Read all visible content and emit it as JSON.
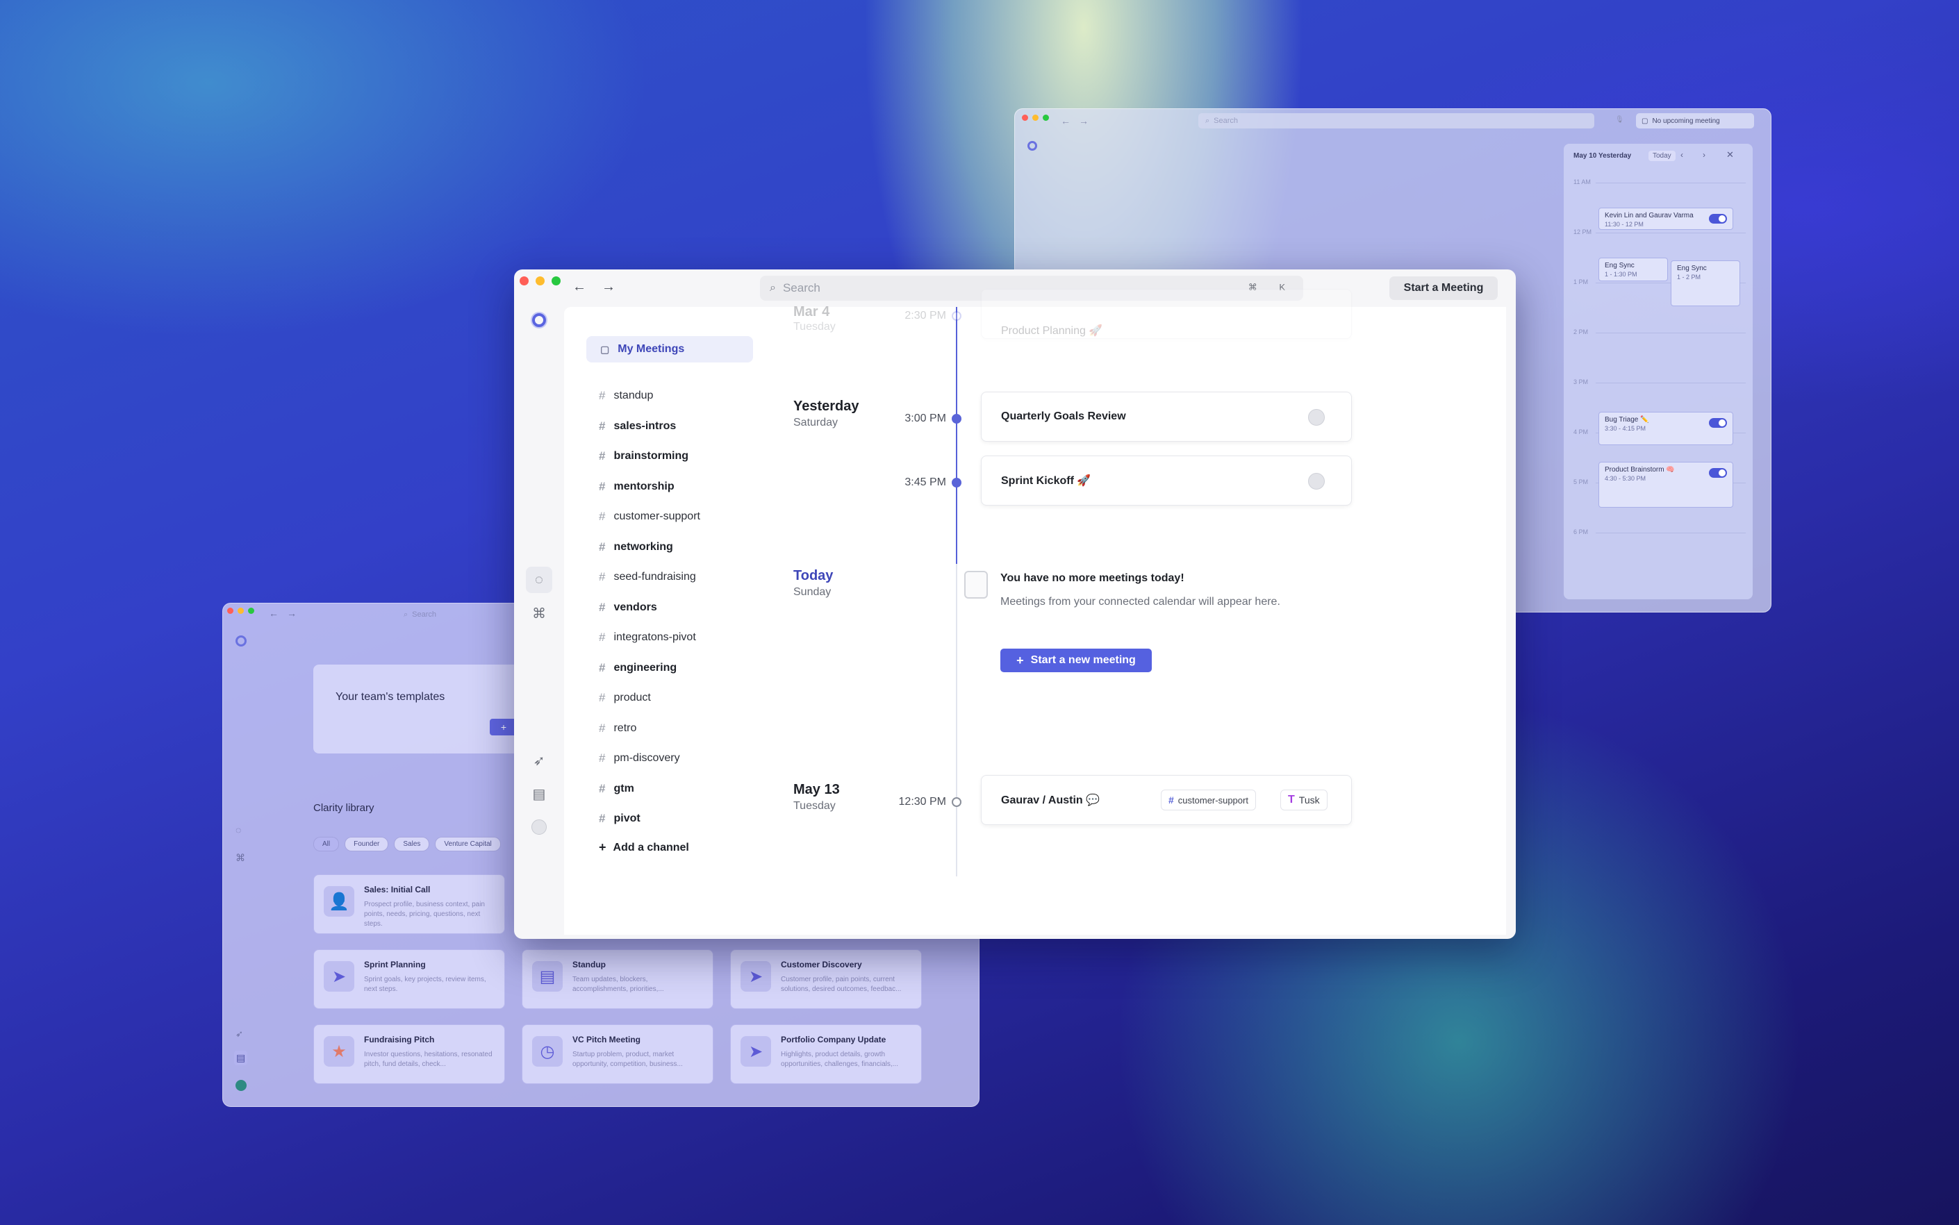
{
  "right_window": {
    "search_placeholder": "Search",
    "no_upcoming": "No upcoming meeting",
    "cal_header_date": "May 10",
    "cal_header_day": "Yesterday",
    "cal_today": "Today",
    "hours": [
      "11 AM",
      "12 PM",
      "1 PM",
      "2 PM",
      "3 PM",
      "4 PM",
      "5 PM",
      "6 PM"
    ],
    "events": [
      {
        "title": "Kevin Lin and Gaurav Varma",
        "time": "11:30 - 12 PM"
      },
      {
        "title": "Eng Sync",
        "time": "1 - 1:30 PM"
      },
      {
        "title": "Eng Sync",
        "time": "1 - 2 PM"
      },
      {
        "title": "Bug Triage ✏️",
        "time": "3:30 - 4:15 PM"
      },
      {
        "title": "Product Brainstorm 🧠",
        "time": "4:30 - 5:30 PM"
      }
    ]
  },
  "left_window": {
    "search_placeholder": "Search",
    "team_templates": "Your team's templates",
    "plus_label": "+",
    "library_title": "Clarity library",
    "filters": [
      "All",
      "Founder",
      "Sales",
      "Venture Capital"
    ],
    "templates": [
      {
        "title": "Sales: Initial Call",
        "desc": "Prospect profile, business context, pain points, needs, pricing, questions, next steps."
      },
      {
        "title": "Sprint Planning",
        "desc": "Sprint goals, key projects, review items, next steps."
      },
      {
        "title": "Standup",
        "desc": "Team updates, blockers, accomplishments, priorities,..."
      },
      {
        "title": "Customer Discovery",
        "desc": "Customer profile, pain points, current solutions, desired outcomes, feedbac..."
      },
      {
        "title": "Fundraising Pitch",
        "desc": "Investor questions, hesitations, resonated pitch, fund details, check..."
      },
      {
        "title": "VC Pitch Meeting",
        "desc": "Startup problem, product, market opportunity, competition, business..."
      },
      {
        "title": "Portfolio Company Update",
        "desc": "Highlights, product details, growth opportunities, challenges, financials,..."
      }
    ]
  },
  "main_window": {
    "search_placeholder": "Search",
    "shortcut": "⌘ K",
    "start_meeting": "Start a Meeting",
    "my_meetings": "My Meetings",
    "channels": [
      {
        "name": "standup",
        "bold": false
      },
      {
        "name": "sales-intros",
        "bold": true
      },
      {
        "name": "brainstorming",
        "bold": true
      },
      {
        "name": "mentorship",
        "bold": true
      },
      {
        "name": "customer-support",
        "bold": false
      },
      {
        "name": "networking",
        "bold": true
      },
      {
        "name": "seed-fundraising",
        "bold": false
      },
      {
        "name": "vendors",
        "bold": true
      },
      {
        "name": "integratons-pivot",
        "bold": false
      },
      {
        "name": "engineering",
        "bold": true
      },
      {
        "name": "product",
        "bold": false
      },
      {
        "name": "retro",
        "bold": false
      },
      {
        "name": "pm-discovery",
        "bold": false
      },
      {
        "name": "gtm",
        "bold": true
      },
      {
        "name": "pivot",
        "bold": true
      }
    ],
    "add_channel": "Add a channel",
    "timeline": {
      "faded_date": "Mar 4",
      "faded_day": "Tuesday",
      "faded_time": "2:30 PM",
      "faded_title": "Product Planning 🚀",
      "yesterday": "Yesterday",
      "yesterday_day": "Saturday",
      "meetings_yesterday": [
        {
          "time": "3:00 PM",
          "title": "Quarterly Goals Review"
        },
        {
          "time": "3:45 PM",
          "title": "Sprint Kickoff 🚀"
        }
      ],
      "today": "Today",
      "today_day": "Sunday",
      "empty_title": "You have no more meetings today!",
      "empty_desc": "Meetings from your connected calendar will appear here.",
      "new_meeting": "Start a new meeting",
      "future_date": "May 13",
      "future_day": "Tuesday",
      "future_time": "12:30 PM",
      "future_title": "Gaurav / Austin 💬",
      "future_tag": "customer-support",
      "future_app": "Tusk"
    }
  },
  "colors": {
    "accent": "#5561e0",
    "today": "#3e46b8",
    "my_meetings_bg": "#eceefb"
  }
}
